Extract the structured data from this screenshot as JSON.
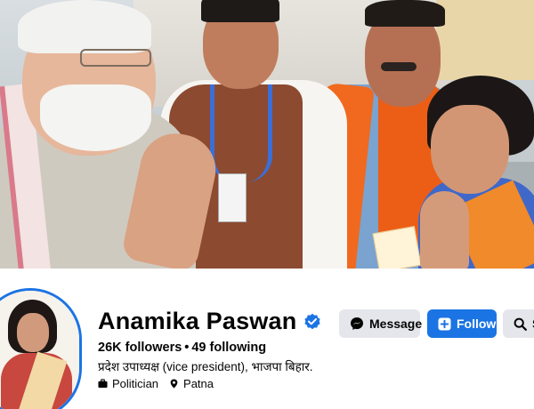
{
  "profile": {
    "name": "Anamika Paswan",
    "verified": true,
    "followers_text": "26K followers",
    "following_text": "49 following",
    "separator": "•",
    "bio": "प्रदेश उपाध्यक्ष (vice president), भाजपा बिहार.",
    "category": "Politician",
    "location": "Patna"
  },
  "actions": {
    "message_label": "Message",
    "follow_label": "Follow",
    "search_label": "S"
  },
  "icons": {
    "verified": "verified-badge-icon",
    "messenger": "messenger-icon",
    "follow": "follow-plus-icon",
    "search": "search-icon",
    "category": "briefcase-icon",
    "location": "location-pin-icon"
  },
  "colors": {
    "accent": "#1b74e4",
    "secondary_button": "#e4e6eb",
    "text": "#050505"
  }
}
